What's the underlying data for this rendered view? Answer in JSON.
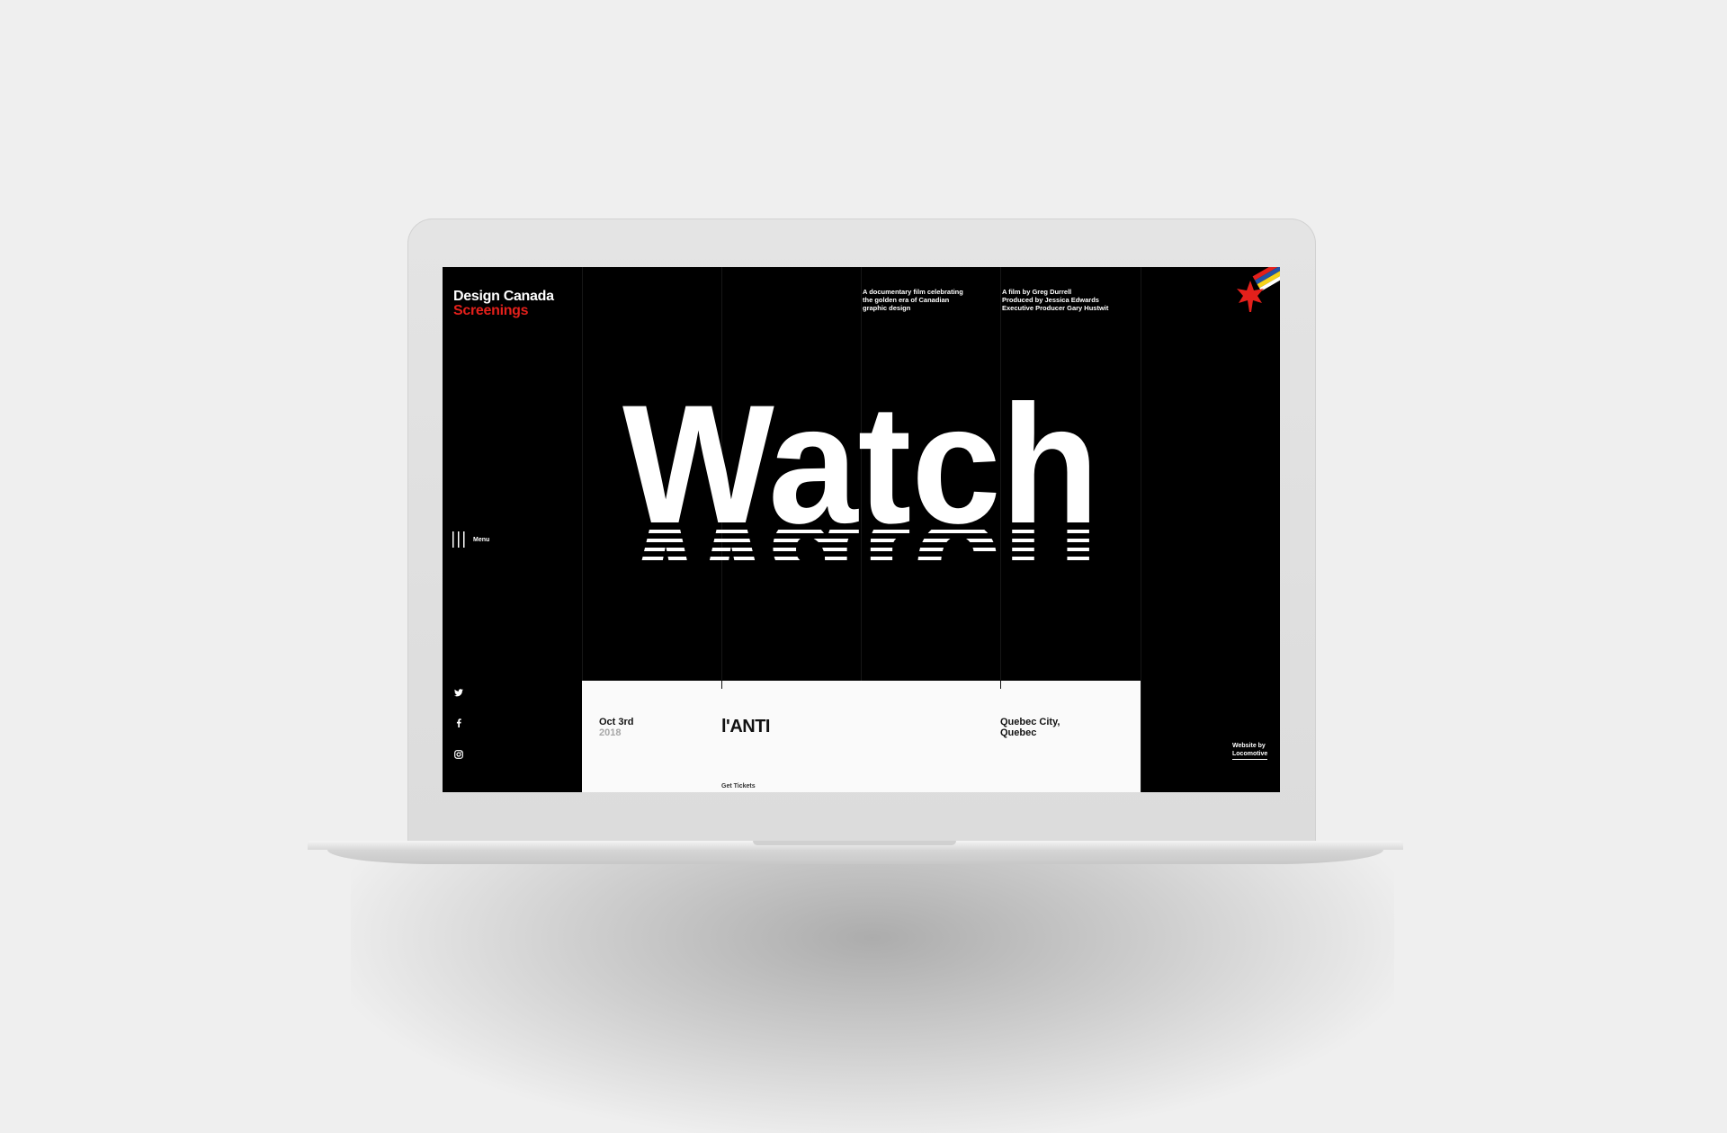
{
  "brand": {
    "line1": "Design Canada",
    "line2": "Screenings",
    "accent_color": "#e3201b"
  },
  "info": {
    "description": [
      "A documentary film celebrating",
      "the golden era of Canadian",
      "graphic design"
    ],
    "credits": [
      "A film by Greg Durrell",
      "Produced by Jessica Edwards",
      "Executive Producer Gary Hustwit"
    ]
  },
  "logo": {
    "icon": "maple-leaf-rainbow-icon",
    "colors": [
      "#e3201b",
      "#2253a6",
      "#f6d21a",
      "#e3201b"
    ]
  },
  "hero": {
    "word": "Watch"
  },
  "menu": {
    "label": "Menu",
    "icon": "menu-bars-icon"
  },
  "social": {
    "icons": [
      "twitter-icon",
      "facebook-icon",
      "instagram-icon"
    ]
  },
  "screening": {
    "date": "Oct 3rd",
    "year": "2018",
    "venue": "l'ANTI",
    "city_line1": "Quebec City,",
    "city_line2": "Quebec",
    "tickets": "Get Tickets"
  },
  "footer": {
    "credit_line1": "Website by",
    "credit_line2": "Locomotive"
  }
}
